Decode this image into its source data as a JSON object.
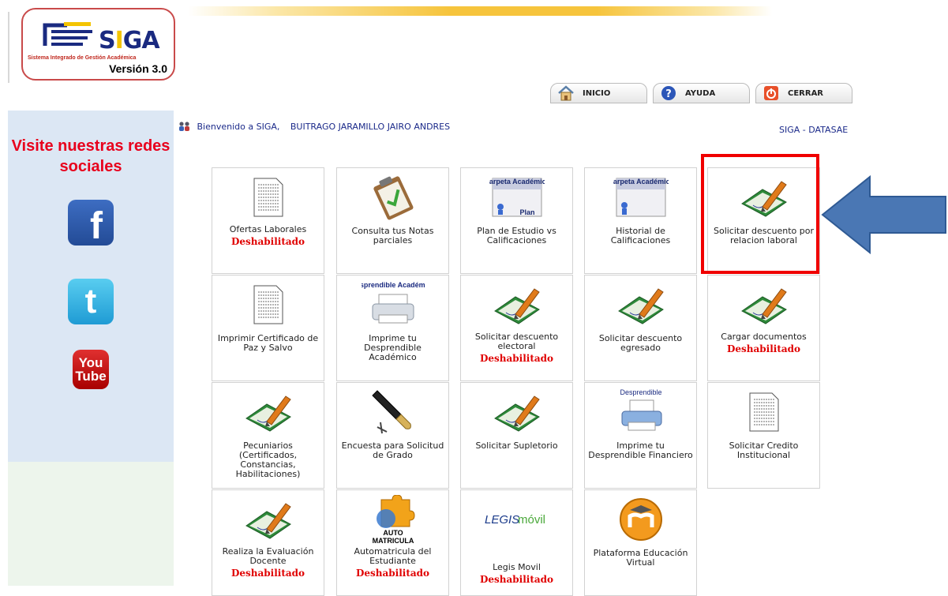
{
  "logo": {
    "brand": "SIGA",
    "subtitle": "Sistema Integrado de Gestión Académica",
    "version": "Versión 3.0"
  },
  "nav": {
    "home": "INICIO",
    "help": "AYUDA",
    "close": "CERRAR"
  },
  "sidebar": {
    "title": "Visite nuestras redes sociales",
    "facebook": "f",
    "twitter": "t",
    "youtube_top": "You",
    "youtube_bottom": "Tube"
  },
  "welcome": {
    "text": "Bienvenido a SIGA,",
    "user": "BUITRAGO JARAMILLO JAIRO ANDRES",
    "link": "SIGA - DATASAE"
  },
  "disabled_label": "Deshabilitado",
  "icon_text": {
    "carpeta": "Carpeta Académica",
    "plan": "Plan",
    "desprendible_academico": "Desprendible Académico",
    "desprendible": "Desprendible",
    "auto": "AUTO",
    "matricula": "MATRICULA",
    "legis": "LEGIS",
    "movil": "móvil"
  },
  "tiles": [
    {
      "label": "Ofertas Laborales",
      "disabled": true,
      "icon": "document-icon"
    },
    {
      "label": "Consulta tus Notas parciales",
      "disabled": false,
      "icon": "clipboard-check-icon"
    },
    {
      "label": "Plan de Estudio vs Calificaciones",
      "disabled": false,
      "icon": "academic-folder-plan-icon"
    },
    {
      "label": "Historial de Calificaciones",
      "disabled": false,
      "icon": "academic-folder-icon"
    },
    {
      "label": "Solicitar descuento por relacion laboral",
      "disabled": false,
      "icon": "book-pen-icon"
    },
    {
      "label": "Imprimir Certificado de Paz y Salvo",
      "disabled": false,
      "icon": "document-icon"
    },
    {
      "label": "Imprime tu Desprendible Académico",
      "disabled": false,
      "icon": "printer-icon"
    },
    {
      "label": "Solicitar descuento electoral",
      "disabled": true,
      "icon": "book-pen-icon"
    },
    {
      "label": "Solicitar descuento egresado",
      "disabled": false,
      "icon": "book-pen-icon"
    },
    {
      "label": "Cargar documentos",
      "disabled": true,
      "icon": "book-pen-icon"
    },
    {
      "label": "Pecuniarios (Certificados, Constancias, Habilitaciones)",
      "disabled": false,
      "icon": "book-pen-icon"
    },
    {
      "label": "Encuesta para Solicitud de Grado",
      "disabled": false,
      "icon": "fountain-pen-icon"
    },
    {
      "label": "Solicitar Supletorio",
      "disabled": false,
      "icon": "book-pen-icon"
    },
    {
      "label": "Imprime tu Desprendible Financiero",
      "disabled": false,
      "icon": "printer-icon"
    },
    {
      "label": "Solicitar Credito Institucional",
      "disabled": false,
      "icon": "document-icon"
    },
    {
      "label": "Realiza la Evaluación Docente",
      "disabled": true,
      "icon": "book-pen-icon"
    },
    {
      "label": "Automatricula del Estudiante",
      "disabled": true,
      "icon": "puzzle-icon"
    },
    {
      "label": "Legis Movil",
      "disabled": true,
      "icon": "legis-movil-logo"
    },
    {
      "label": "Plataforma Educación Virtual",
      "disabled": false,
      "icon": "moodle-icon"
    }
  ],
  "colors": {
    "disabled": "#e00000",
    "link": "#1b2a8a",
    "highlight": "#f00000",
    "arrow": "#4a77b4",
    "social_title": "#e8001c"
  }
}
